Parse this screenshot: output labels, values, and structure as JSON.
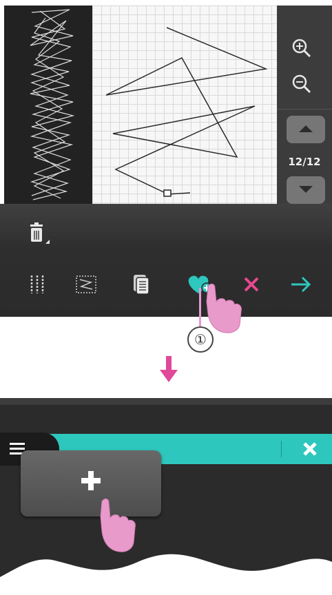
{
  "zoom": {
    "in_icon": "zoom-in-icon",
    "out_icon": "zoom-out-icon"
  },
  "pager": {
    "counter": "12/12",
    "up_icon": "arrow-up-icon",
    "down_icon": "arrow-down-icon"
  },
  "toolbar": {
    "delete_icon": "trash-icon",
    "buttons": [
      {
        "name": "stitch-columns-icon",
        "color": "#d0d0d0"
      },
      {
        "name": "stitch-select-icon",
        "color": "#d0d0d0"
      },
      {
        "name": "copy-icon",
        "color": "#d0d0d0"
      },
      {
        "name": "add-favorite-heart-icon",
        "color": "#2ec7bd"
      },
      {
        "name": "cancel-x-icon",
        "color": "#e8488f"
      },
      {
        "name": "confirm-arrow-icon",
        "color": "#2ec7bd"
      }
    ]
  },
  "callout": {
    "number": "①"
  },
  "bottom": {
    "menu_icon": "hamburger-menu-icon",
    "close_icon": "close-icon",
    "add_icon": "plus-icon"
  },
  "colors": {
    "teal": "#2ec7bd",
    "pink": "#e8488f",
    "hand": "#e89acb",
    "arrow": "#e0489a",
    "dark": "#2c2c2c"
  }
}
